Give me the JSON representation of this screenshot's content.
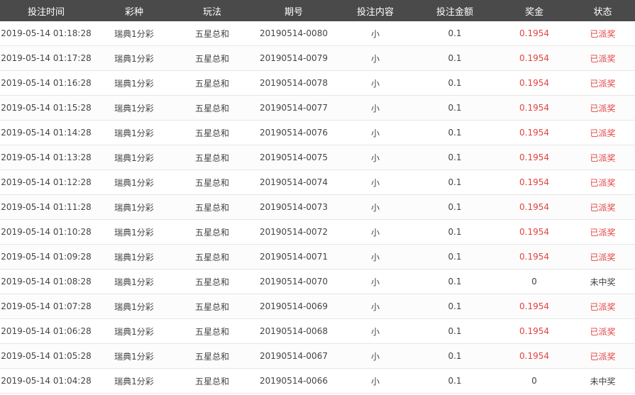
{
  "colors": {
    "header_bg": "#4a4a4a",
    "win": "#e2423f",
    "text": "#444444"
  },
  "headers": [
    "投注时间",
    "彩种",
    "玩法",
    "期号",
    "投注内容",
    "投注金额",
    "奖金",
    "状态"
  ],
  "rows": [
    {
      "time": "2019-05-14 01:18:28",
      "lottery": "瑞典1分彩",
      "play": "五星总和",
      "issue": "20190514-0080",
      "content": "小",
      "amount": "0.1",
      "prize": "0.1954",
      "status": "已派奖",
      "win": true
    },
    {
      "time": "2019-05-14 01:17:28",
      "lottery": "瑞典1分彩",
      "play": "五星总和",
      "issue": "20190514-0079",
      "content": "小",
      "amount": "0.1",
      "prize": "0.1954",
      "status": "已派奖",
      "win": true
    },
    {
      "time": "2019-05-14 01:16:28",
      "lottery": "瑞典1分彩",
      "play": "五星总和",
      "issue": "20190514-0078",
      "content": "小",
      "amount": "0.1",
      "prize": "0.1954",
      "status": "已派奖",
      "win": true
    },
    {
      "time": "2019-05-14 01:15:28",
      "lottery": "瑞典1分彩",
      "play": "五星总和",
      "issue": "20190514-0077",
      "content": "小",
      "amount": "0.1",
      "prize": "0.1954",
      "status": "已派奖",
      "win": true
    },
    {
      "time": "2019-05-14 01:14:28",
      "lottery": "瑞典1分彩",
      "play": "五星总和",
      "issue": "20190514-0076",
      "content": "小",
      "amount": "0.1",
      "prize": "0.1954",
      "status": "已派奖",
      "win": true
    },
    {
      "time": "2019-05-14 01:13:28",
      "lottery": "瑞典1分彩",
      "play": "五星总和",
      "issue": "20190514-0075",
      "content": "小",
      "amount": "0.1",
      "prize": "0.1954",
      "status": "已派奖",
      "win": true
    },
    {
      "time": "2019-05-14 01:12:28",
      "lottery": "瑞典1分彩",
      "play": "五星总和",
      "issue": "20190514-0074",
      "content": "小",
      "amount": "0.1",
      "prize": "0.1954",
      "status": "已派奖",
      "win": true
    },
    {
      "time": "2019-05-14 01:11:28",
      "lottery": "瑞典1分彩",
      "play": "五星总和",
      "issue": "20190514-0073",
      "content": "小",
      "amount": "0.1",
      "prize": "0.1954",
      "status": "已派奖",
      "win": true
    },
    {
      "time": "2019-05-14 01:10:28",
      "lottery": "瑞典1分彩",
      "play": "五星总和",
      "issue": "20190514-0072",
      "content": "小",
      "amount": "0.1",
      "prize": "0.1954",
      "status": "已派奖",
      "win": true
    },
    {
      "time": "2019-05-14 01:09:28",
      "lottery": "瑞典1分彩",
      "play": "五星总和",
      "issue": "20190514-0071",
      "content": "小",
      "amount": "0.1",
      "prize": "0.1954",
      "status": "已派奖",
      "win": true
    },
    {
      "time": "2019-05-14 01:08:28",
      "lottery": "瑞典1分彩",
      "play": "五星总和",
      "issue": "20190514-0070",
      "content": "小",
      "amount": "0.1",
      "prize": "0",
      "status": "未中奖",
      "win": false
    },
    {
      "time": "2019-05-14 01:07:28",
      "lottery": "瑞典1分彩",
      "play": "五星总和",
      "issue": "20190514-0069",
      "content": "小",
      "amount": "0.1",
      "prize": "0.1954",
      "status": "已派奖",
      "win": true
    },
    {
      "time": "2019-05-14 01:06:28",
      "lottery": "瑞典1分彩",
      "play": "五星总和",
      "issue": "20190514-0068",
      "content": "小",
      "amount": "0.1",
      "prize": "0.1954",
      "status": "已派奖",
      "win": true
    },
    {
      "time": "2019-05-14 01:05:28",
      "lottery": "瑞典1分彩",
      "play": "五星总和",
      "issue": "20190514-0067",
      "content": "小",
      "amount": "0.1",
      "prize": "0.1954",
      "status": "已派奖",
      "win": true
    },
    {
      "time": "2019-05-14 01:04:28",
      "lottery": "瑞典1分彩",
      "play": "五星总和",
      "issue": "20190514-0066",
      "content": "小",
      "amount": "0.1",
      "prize": "0",
      "status": "未中奖",
      "win": false
    }
  ]
}
